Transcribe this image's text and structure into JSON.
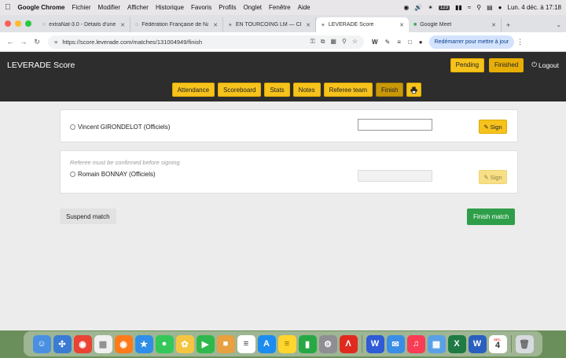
{
  "menubar": {
    "app": "Google Chrome",
    "items": [
      "Fichier",
      "Modifier",
      "Afficher",
      "Historique",
      "Favoris",
      "Profils",
      "Onglet",
      "Fenêtre",
      "Aide"
    ],
    "badge": "123",
    "clock": "Lun. 4 déc. à 17:18"
  },
  "tabs": [
    {
      "title": "extraNat-3.0 - Détails d'une"
    },
    {
      "title": "Fédération Française de Nata"
    },
    {
      "title": "EN TOURCOING LM — CERC"
    },
    {
      "title": "LEVERADE Score"
    },
    {
      "title": "Google Meet"
    }
  ],
  "toolbar": {
    "url": "https://score.leverade.com/matches/131004949/finish",
    "relaunch": "Redémarrer pour mettre à jour"
  },
  "app": {
    "brand": "LEVERADE Score",
    "pending": "Pending",
    "finished": "Finished",
    "logout": "Logout"
  },
  "nav": [
    "Attendance",
    "Scoreboard",
    "Stats",
    "Notes",
    "Referee team",
    "Finish"
  ],
  "officials": [
    {
      "name": "Vincent GIRONDELOT (Officiels)",
      "sign": "Sign",
      "note": ""
    },
    {
      "name": "Romain BONNAY (Officiels)",
      "sign": "Sign",
      "note": "Referee must be confirmed before signing"
    }
  ],
  "actions": {
    "suspend": "Suspend match",
    "finish": "Finish match"
  },
  "dock": {
    "calendar_month": "DÉC.",
    "calendar_day": "4"
  },
  "colors": {
    "accent": "#f6c21c",
    "header": "#2d2d2d",
    "success": "#2e9e48"
  }
}
